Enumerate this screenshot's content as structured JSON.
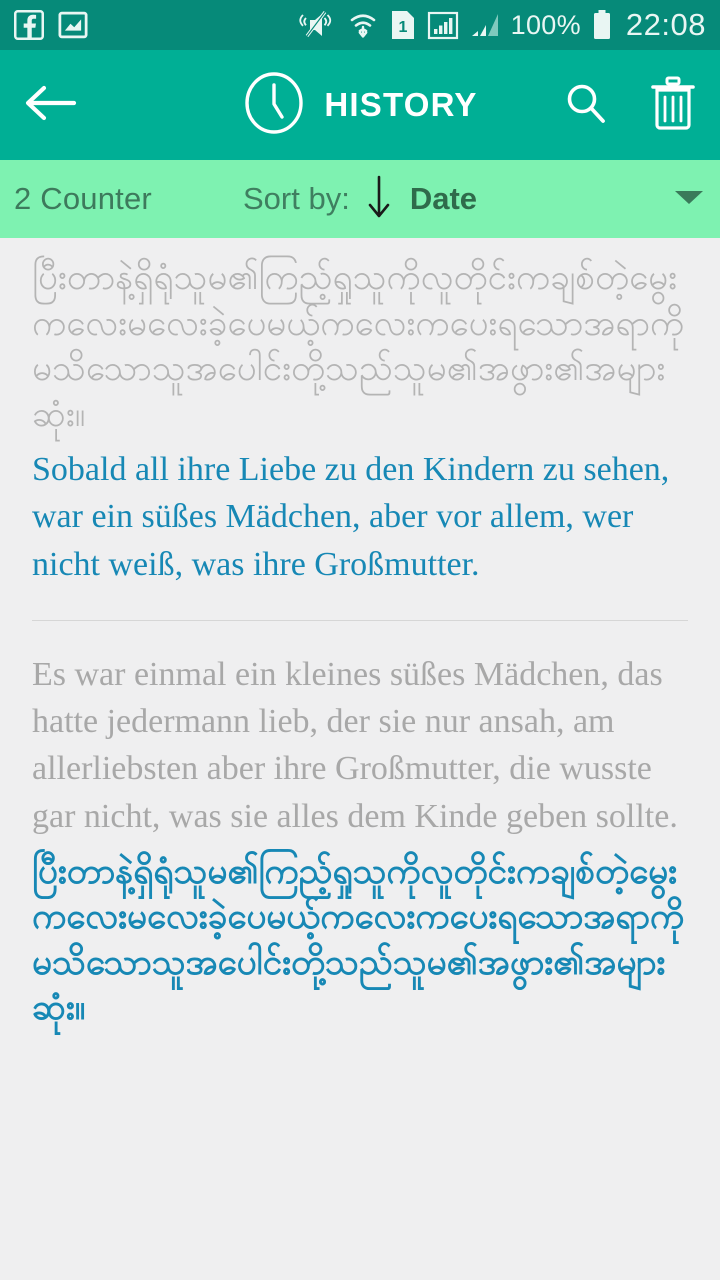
{
  "statusbar": {
    "left_icons": [
      "facebook-icon",
      "photo-icon"
    ],
    "right_icons": [
      "mute-vibrate-icon",
      "wifi-icon",
      "sim1-icon",
      "signal-full-icon",
      "signal-second-icon"
    ],
    "battery_percent": "100%",
    "battery_icon": "battery-full-icon",
    "time": "22:08",
    "bg_color": "#068A79"
  },
  "appbar": {
    "back_icon": "back-arrow-icon",
    "clock_icon": "clock-icon",
    "title": "HISTORY",
    "search_icon": "search-icon",
    "delete_icon": "trash-icon",
    "bg_color": "#00AF95"
  },
  "sortbar": {
    "counter_label": "2 Counter",
    "sort_label": "Sort by:",
    "sort_direction_icon": "arrow-down-icon",
    "sort_value": "Date",
    "dropdown_icon": "chevron-down-icon",
    "bg_color": "#7EF2B1"
  },
  "history": {
    "items": [
      {
        "source_text": "ပြီးတာနဲ့ရှိရုံသူမ၏ကြည့်ရှုသူကိုလူတိုင်းကချစ်တဲ့မွေးကလေးမလေးခဲ့ပေမယ့်ကလေးကပေးရသောအရာကိုမသိသောသူအပေါင်းတို့သည်သူမ၏အဖွား၏အများဆုံး။",
        "translated_text": "Sobald all ihre Liebe zu den Kindern zu sehen, war ein süßes Mädchen, aber vor allem, wer nicht weiß, was ihre Großmutter."
      },
      {
        "source_text": "Es war einmal ein kleines süßes Mädchen, das hatte jedermann lieb, der sie nur ansah, am allerliebsten aber ihre Großmutter, die wusste gar nicht, was sie alles dem Kinde geben sollte.",
        "translated_text": "ပြီးတာနဲ့ရှိရုံသူမ၏ကြည့်ရှုသူကိုလူတိုင်းကချစ်တဲ့မွေးကလေးမလေးခဲ့ပေမယ့်ကလေးကပေးရသောအရာကိုမသိသောသူအပေါင်းတို့သည်သူမ၏အဖွား၏အများဆုံး။"
      }
    ]
  },
  "colors": {
    "accent_blue": "#1788B5",
    "muted_grey": "#b0b0b0",
    "page_bg": "#efeff0"
  }
}
